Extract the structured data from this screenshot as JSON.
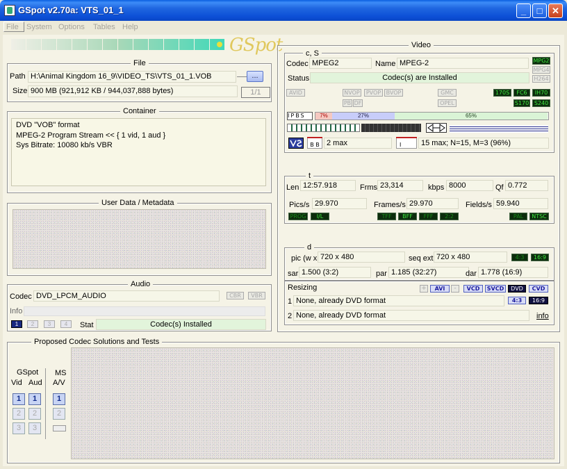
{
  "window": {
    "title": "GSpot v2.70a: VTS_01_1",
    "minimize": "_",
    "maximize": "□",
    "close": "✕"
  },
  "menu": [
    "File",
    "System",
    "Options",
    "Tables",
    "Help"
  ],
  "logo": "GSpot",
  "file": {
    "title": "File",
    "path_label": "Path",
    "path": "H:\\Animal Kingdom 16_9\\VIDEO_TS\\VTS_01_1.VOB",
    "browse": "...",
    "size_label": "Size",
    "size": "900 MB (921,912 KB / 944,037,888 bytes)",
    "page": "1/1"
  },
  "container": {
    "title": "Container",
    "lines": [
      "DVD \"VOB\" format",
      "MPEG-2 Program Stream << { 1 vid, 1 aud }",
      "Sys Bitrate: 10080 kb/s VBR"
    ]
  },
  "userdata": {
    "title": "User Data / Metadata"
  },
  "audio": {
    "title": "Audio",
    "codec_label": "Codec",
    "codec": "DVD_LPCM_AUDIO",
    "cbr": "CBR",
    "vbr": "VBR",
    "info_label": "Info",
    "tracks": [
      "1",
      "2",
      "3",
      "4"
    ],
    "stat_label": "Stat",
    "stat": "Codec(s) Installed"
  },
  "proposed": {
    "title": "Proposed Codec Solutions and Tests",
    "gspot_label": "GSpot",
    "vid_label": "Vid",
    "aud_label": "Aud",
    "ms_label": "MS",
    "av_label": "A/V",
    "buttons": [
      "1",
      "2",
      "3"
    ]
  },
  "video": {
    "title": "Video",
    "cs_title": "c, S",
    "codec_label": "Codec",
    "codec": "MPEG2",
    "name_label": "Name",
    "name": "MPEG-2",
    "status_label": "Status",
    "status": "Codec(s) are Installed",
    "fmt_tags": [
      "MPG2",
      "MPG4",
      "H264"
    ],
    "flag_tags": [
      "AVID",
      "NVOP",
      "PVOP",
      "BVOP",
      "GMC",
      "PB",
      "DF",
      "OPEL"
    ],
    "std_tags": [
      "170S",
      "FC6",
      "IH70",
      "S170",
      "S240"
    ],
    "frame_types": [
      "I",
      "P",
      "B",
      "S"
    ],
    "i_pct": "7%",
    "p_pct": "27%",
    "b_pct": "65%",
    "i_fraction": 0.07,
    "p_fraction": 0.27,
    "b_fraction": 0.65,
    "bb_tag": "B B",
    "max_b": "2 max",
    "gop_tag": "I",
    "gop": "15 max; N=15, M=3 (96%)",
    "t_title": "t",
    "len_label": "Len",
    "len": "12:57.918",
    "frms_label": "Frms",
    "frms": "23,314",
    "kbps_label": "kbps",
    "kbps": "8000",
    "qf_label": "Qf",
    "qf": "0.772",
    "pics_label": "Pics/s",
    "pics": "29.970",
    "frames_label": "Frames/s",
    "frames": "29.970",
    "fields_label": "Fields/s",
    "fields": "59.940",
    "scan_tags": [
      "PROG",
      "I/L",
      "TFF",
      "BFF",
      "FFF",
      "2:2",
      "PAL",
      "NTSC"
    ],
    "d_title": "d",
    "pic_label": "pic (w x h)",
    "pic": "720 x 480",
    "seqext_label": "seq ext",
    "seqext": "720 x 480",
    "ar_tags": [
      "4:3",
      "16:9"
    ],
    "sar_label": "sar",
    "sar": "1.500 (3:2)",
    "par_label": "par",
    "par": "1.185 (32:27)",
    "dar_label": "dar",
    "dar": "1.778 (16:9)",
    "resizing_label": "Resizing",
    "plus": "+",
    "avi": "AVI",
    "minus": "-",
    "vcd": "VCD",
    "svcd": "SVCD",
    "dvd": "DVD",
    "cvd": "CVD",
    "r1_label": "1",
    "r1": "None, already DVD format",
    "r2_label": "2",
    "r2": "None, already DVD format",
    "ar43": "4:3",
    "ar169": "16:9",
    "info_link": "info"
  }
}
